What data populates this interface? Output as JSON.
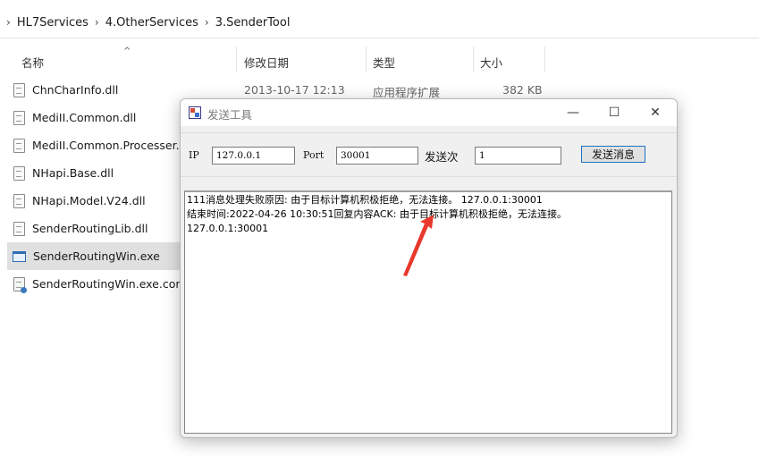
{
  "explorer": {
    "breadcrumb": [
      "HL7Services",
      "4.OtherServices",
      "3.SenderTool"
    ],
    "columns": {
      "name": "名称",
      "date": "修改日期",
      "type": "类型",
      "size": "大小"
    },
    "sort_indicator": "^",
    "files": [
      {
        "name": "ChnCharInfo.dll",
        "date": "2013-10-17 12:13",
        "type": "应用程序扩展",
        "size": "382 KB",
        "icon": "dll-file-icon"
      },
      {
        "name": "MediII.Common.dll",
        "icon": "dll-file-icon"
      },
      {
        "name": "MediII.Common.Processer.dll",
        "icon": "dll-file-icon"
      },
      {
        "name": "NHapi.Base.dll",
        "icon": "dll-file-icon"
      },
      {
        "name": "NHapi.Model.V24.dll",
        "icon": "dll-file-icon"
      },
      {
        "name": "SenderRoutingLib.dll",
        "icon": "dll-file-icon"
      },
      {
        "name": "SenderRoutingWin.exe",
        "icon": "exe-file-icon",
        "selected": true
      },
      {
        "name": "SenderRoutingWin.exe.config",
        "icon": "config-file-icon"
      }
    ]
  },
  "dialog": {
    "title": "发送工具",
    "controls": {
      "minimize": "—",
      "maximize": "☐",
      "close": "✕"
    },
    "ip_label": "IP",
    "ip_value": "127.0.0.1",
    "port_label": "Port",
    "port_value": "30001",
    "count_label": "发送次",
    "count_value": "1",
    "send_button": "发送消息",
    "log_lines": [
      "111消息处理失败原因: 由于目标计算机积极拒绝，无法连接。 127.0.0.1:30001",
      "结束时间:2022-04-26 10:30:51回复内容ACK: 由于目标计算机积极拒绝，无法连接。",
      "127.0.0.1:30001"
    ]
  },
  "colors": {
    "annotation_arrow": "#e8392c",
    "accent": "#1f6fc5"
  }
}
